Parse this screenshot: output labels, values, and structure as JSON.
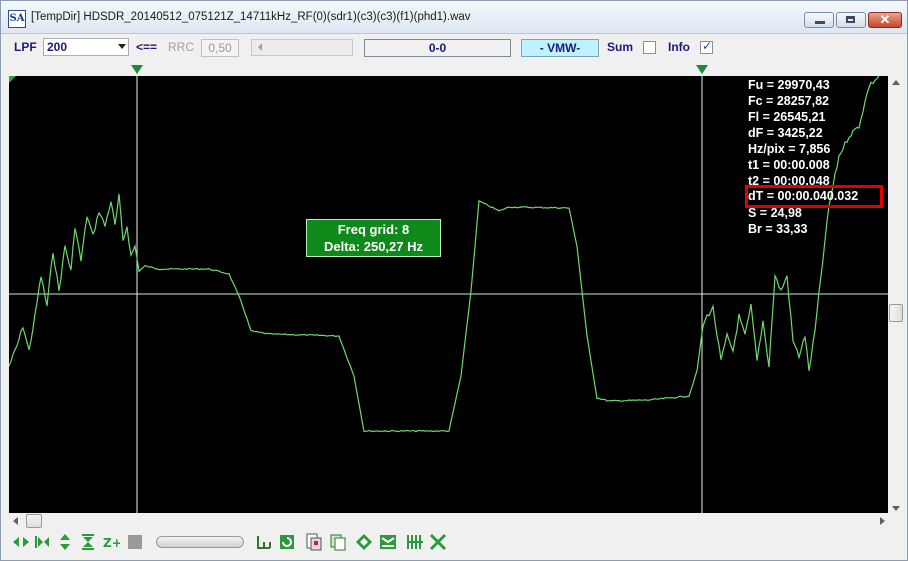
{
  "window": {
    "icon_text": "SA",
    "title": "[TempDir] HDSDR_20140512_075121Z_14711kHz_RF(0)(sdr1)(c3)(c3)(f1)(phd1).wav"
  },
  "toolbar": {
    "lpf_label": "LPF",
    "lpf_value": "200",
    "arrow_label": "<==",
    "rrc_label": "RRC",
    "rrc_value": "0,50",
    "range_readout": "0-0",
    "mode_label": "- VMW-",
    "sum_label": "Sum",
    "sum_checked": false,
    "info_label": "Info",
    "info_checked": true
  },
  "info_panel": {
    "lines": [
      "Fu = 29970,43",
      "Fc = 28257,82",
      "Fl = 26545,21",
      "dF = 3425,22",
      "Hz/pix = 7,856",
      "t1 = 00:00.008",
      "t2 = 00:00.048"
    ],
    "dt_line": "dT = 00:00.040.032",
    "tail_lines": [
      "S = 24,98",
      "Br = 33,33"
    ]
  },
  "freq_grid": {
    "line1": "Freq grid: 8",
    "line2": "Delta: 250,27 Hz"
  },
  "colors": {
    "plot_bg": "#000000",
    "trace": "#6fd86f",
    "cursor": "#e6ffe6",
    "highlight": "#e00000",
    "freqbox_bg": "#0f8a1a"
  },
  "icons": [
    "fit-horizontal-icon",
    "shrink-horizontal-icon",
    "fit-vertical-icon",
    "shrink-vertical-icon",
    "zoom-plus-icon",
    "stop-icon",
    "baseline-icon",
    "refresh-icon",
    "save-image-icon",
    "copy-icon",
    "diamond-icon",
    "compress-icon",
    "grid-icon",
    "cross-icon"
  ]
}
